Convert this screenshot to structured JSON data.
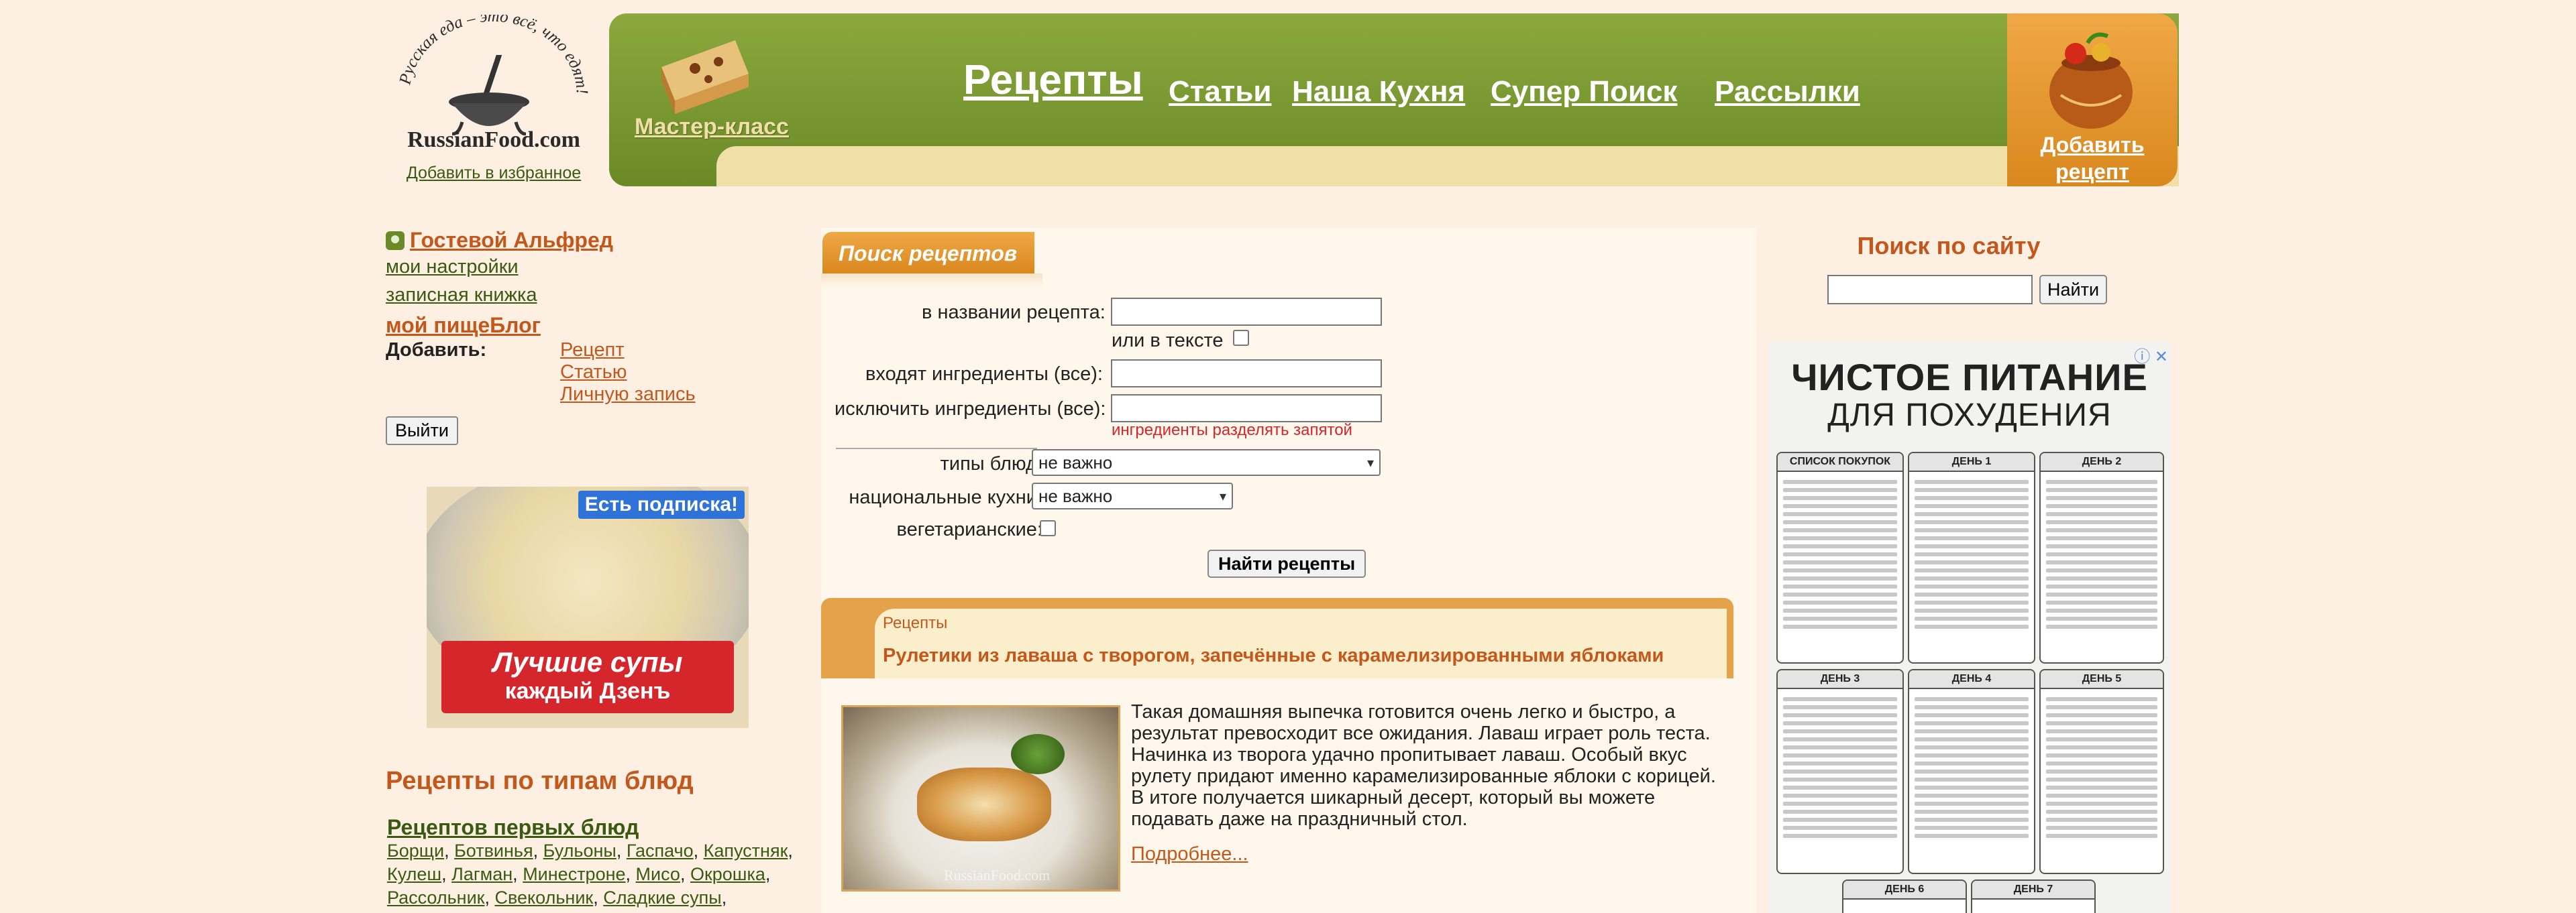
{
  "header": {
    "logo_slogan": "Русская еда – это всё, что едят!",
    "logo_site": "RussianFood.com",
    "favorites_link": "Добавить в избранное",
    "master_class": "Мастер-класс",
    "nav": [
      "Рецепты",
      "Статьи",
      "Наша Кухня",
      "Супер Поиск",
      "Рассылки"
    ],
    "add_recipe": "Добавить рецепт"
  },
  "user": {
    "guest": "Гостевой Альфред",
    "settings": "мои настройки",
    "notebook": "записная книжка",
    "blog": "мой пищеБлог",
    "add_label": "Добавить:",
    "add_items": [
      "Рецепт",
      "Статью",
      "Личную запись"
    ],
    "logout": "Выйти"
  },
  "left_ad": {
    "badge": "Есть подписка!",
    "line1": "Лучшие супы",
    "line2": "каждый Дзенъ"
  },
  "dish_types": {
    "title": "Рецепты по типам блюд",
    "first_title": "Рецептов первых блюд",
    "first_items": [
      "Борщи",
      "Ботвинья",
      "Бульоны",
      "Гаспачо",
      "Капустняк",
      "Кулеш",
      "Лагман",
      "Минестроне",
      "Мисо",
      "Окрошка",
      "Рассольник",
      "Свекольник",
      "Сладкие супы"
    ]
  },
  "search_form": {
    "tab": "Поиск рецептов",
    "name_label": "в названии рецепта:",
    "or_text_label": "или в тексте",
    "include_label": "входят ингредиенты (все):",
    "exclude_label": "исключить ингредиенты (все):",
    "hint": "ингредиенты разделять запятой",
    "dish_types_label": "типы блюд:",
    "dish_types_value": "не важно",
    "cuisines_label": "национальные кухни:",
    "cuisines_value": "не важно",
    "vegetarian_label": "вегетарианские:",
    "submit": "Найти рецепты"
  },
  "recipe": {
    "category": "Рецепты",
    "title": "Рулетики из лаваша с творогом, запечённые с карамелизированными яблоками",
    "description": "Такая домашняя выпечка готовится очень легко и быстро, а результат превосходит все ожидания. Лаваш играет роль теста. Начинка из творога удачно пропитывает лаваш. Особый вкус рулету придают именно карамелизированные яблоки с корицей. В итоге получается шикарный десерт, который вы можете подавать даже на праздничный стол.",
    "more": "Подробнее...",
    "image_watermark": "RussianFood.com"
  },
  "site_search": {
    "title": "Поиск по сайту",
    "button": "Найти"
  },
  "right_ad": {
    "title1": "ЧИСТОЕ ПИТАНИЕ",
    "title2": "ДЛЯ ПОХУДЕНИЯ",
    "boxes": [
      "СПИСОК ПОКУПОК",
      "ДЕНЬ 1",
      "ДЕНЬ 2",
      "ДЕНЬ 3",
      "ДЕНЬ 4",
      "ДЕНЬ 5",
      "ДЕНЬ 6",
      "ДЕНЬ 7"
    ]
  },
  "colors": {
    "page_bg": "#fdf0e2",
    "nav_green": "#6a8a27",
    "accent_orange": "#c4581c",
    "tab_orange": "#e4a34a",
    "cream": "#f1dfa8"
  }
}
